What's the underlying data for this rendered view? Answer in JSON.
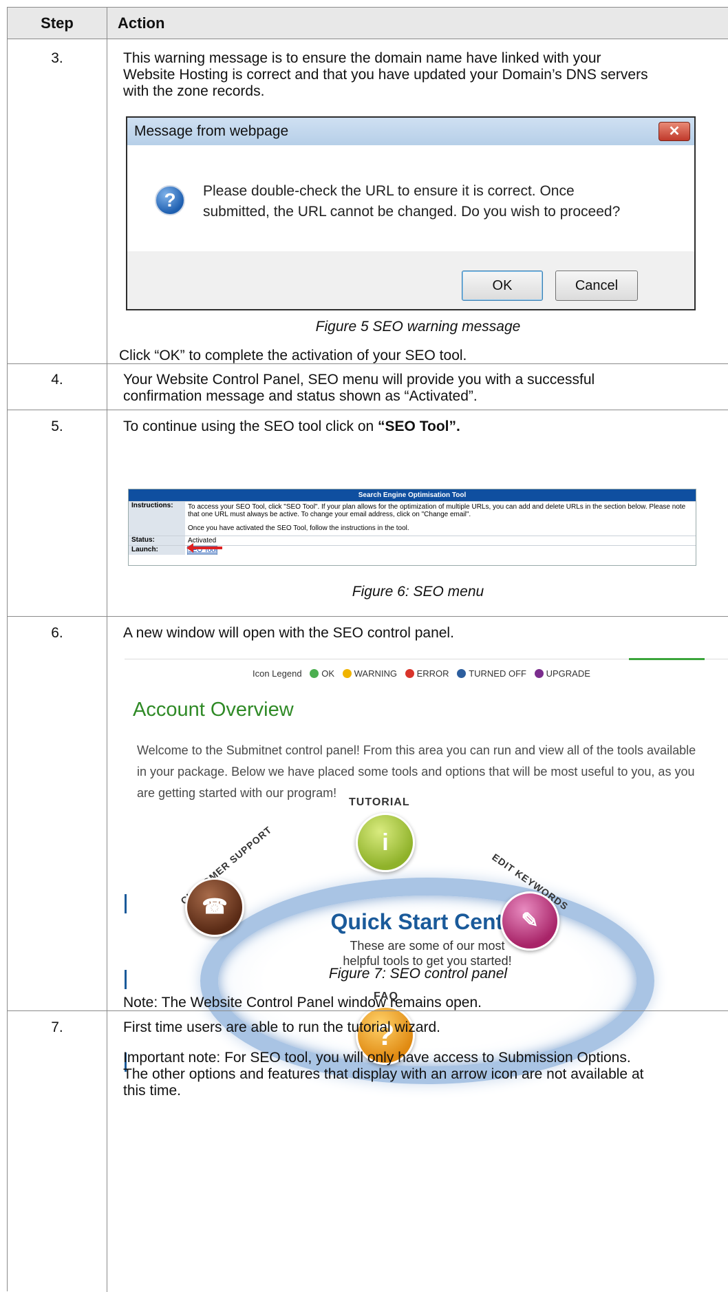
{
  "header": {
    "step": "Step",
    "action": "Action"
  },
  "rows": [
    {
      "step": "3.",
      "text1": "This warning message is to ensure the domain name have linked with your",
      "text2": "Website Hosting is correct and that you have updated your Domain’s DNS servers",
      "text3": "with the zone records.",
      "dialog": {
        "title": "Message from webpage",
        "close": "✕",
        "icon": "question-icon",
        "message1": "Please double-check the URL to ensure it is correct. Once",
        "message2": "submitted, the URL cannot be changed. Do you wish to proceed?",
        "ok": "OK",
        "cancel": "Cancel"
      },
      "caption": "Figure 5 SEO warning message",
      "after": "Click “OK” to complete the activation of your SEO tool."
    },
    {
      "step": "4.",
      "text1": "Your Website Control Panel, SEO menu will provide you with a successful",
      "text2": "confirmation message and status shown as “Activated”."
    },
    {
      "step": "5.",
      "text1": "To continue using the SEO tool click on ",
      "bold": "“SEO Tool”.",
      "seo_menu": {
        "title": "Search Engine Optimisation Tool",
        "instructions_label": "Instructions:",
        "instructions_line1": "To access your SEO Tool, click \"SEO Tool\". If your plan allows for the optimization of multiple URLs, you can add and delete URLs in the section below. Please note",
        "instructions_line2": "that one URL must always be active. To change your email address, click on \"Change email\".",
        "instructions_line3": "Once you have activated the SEO Tool, follow the instructions in the tool.",
        "status_label": "Status:",
        "status_value": "Activated",
        "launch_label": "Launch:",
        "launch_link": "SEO Tool"
      },
      "caption": "Figure 6: SEO menu"
    },
    {
      "step": "6.",
      "text1": "A new window will open with the SEO control panel.",
      "panel": {
        "legend_title": "Icon Legend",
        "legend_items": [
          "OK",
          "WARNING",
          "ERROR",
          "TURNED OFF",
          "UPGRADE"
        ],
        "legend_colors": [
          "#4caf50",
          "#f0b400",
          "#d9342b",
          "#2c5e9e",
          "#7b2d8e"
        ],
        "title": "Account Overview",
        "body1": "Welcome to the Submitnet control panel! From this area you can run and view all of the tools available",
        "body2": "in your package. Below we have placed some tools and options that will be most useful to you, as you",
        "body3": "are getting started with our program!",
        "qsc_title": "Quick Start Center",
        "qsc_sub1": "These are some of our most",
        "qsc_sub2": "helpful tools to get you started!",
        "tutorial": "TUTORIAL",
        "customer_support": "CUSTOMER SUPPORT",
        "edit_keywords": "EDIT KEYWORDS",
        "faq": "FAQ"
      },
      "caption": "Figure 7: SEO control panel",
      "after": "Note: The Website Control Panel window remains open."
    },
    {
      "step": "7.",
      "text1": "First time users are able to run the tutorial wizard.",
      "text2": "Important note: For SEO tool, you will only have access to Submission Options.",
      "text3": "The other options and features that display with an arrow icon are not available at",
      "text4": "this time."
    }
  ]
}
